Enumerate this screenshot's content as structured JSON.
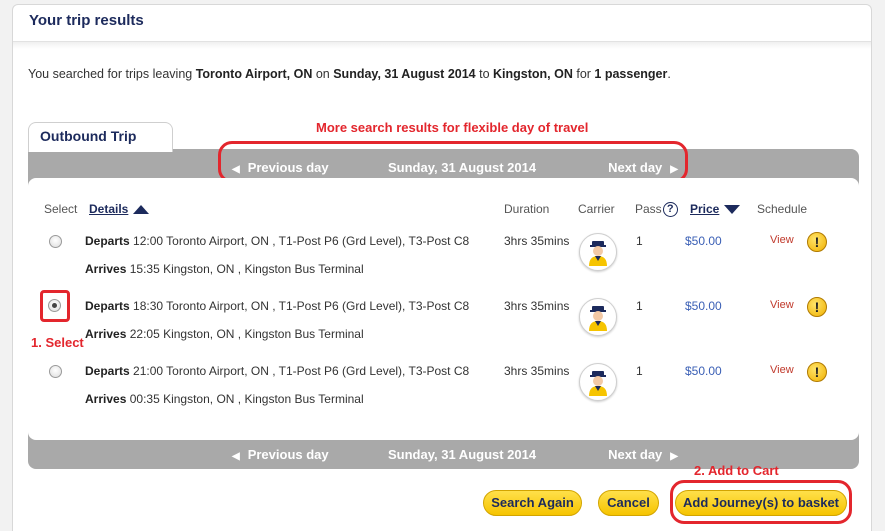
{
  "page": {
    "title": "Your trip results"
  },
  "summary": {
    "prefix": "You searched for trips leaving ",
    "origin": "Toronto Airport, ON",
    "on": " on ",
    "date": "Sunday, 31 August 2014",
    "to": " to ",
    "destination": "Kingston, ON",
    "for": " for ",
    "passengers": "1 passenger",
    "suffix": "."
  },
  "tab": {
    "label": "Outbound Trip"
  },
  "annotations": {
    "flexible": "More search results for flexible day of travel",
    "select": "1. Select",
    "cart": "2. Add to Cart"
  },
  "daynav": {
    "prev": "Previous day",
    "date": "Sunday, 31 August 2014",
    "next": "Next day",
    "prev_icon": "chevron-left-icon",
    "next_icon": "chevron-right-icon"
  },
  "columns": {
    "select": "Select",
    "details": "Details",
    "duration": "Duration",
    "carrier": "Carrier",
    "pass": "Pass",
    "price": "Price",
    "schedule": "Schedule"
  },
  "trips": [
    {
      "departs_label": "Departs",
      "departs": "12:00 Toronto Airport, ON , T1-Post P6 (Grd Level), T3-Post C8",
      "arrives_label": "Arrives",
      "arrives": "15:35 Kingston, ON , Kingston Bus Terminal",
      "duration": "3hrs 35mins",
      "pass": "1",
      "price": "$50.00",
      "view": "View",
      "selected": false
    },
    {
      "departs_label": "Departs",
      "departs": "18:30 Toronto Airport, ON , T1-Post P6 (Grd Level), T3-Post C8",
      "arrives_label": "Arrives",
      "arrives": "22:05 Kingston, ON , Kingston Bus Terminal",
      "duration": "3hrs 35mins",
      "pass": "1",
      "price": "$50.00",
      "view": "View",
      "selected": true
    },
    {
      "departs_label": "Departs",
      "departs": "21:00 Toronto Airport, ON , T1-Post P6 (Grd Level), T3-Post C8",
      "arrives_label": "Arrives",
      "arrives": "00:35 Kingston, ON , Kingston Bus Terminal",
      "duration": "3hrs 35mins",
      "pass": "1",
      "price": "$50.00",
      "view": "View",
      "selected": false
    }
  ],
  "buttons": {
    "search_again": "Search Again",
    "cancel": "Cancel",
    "add_to_basket": "Add Journey(s) to basket"
  },
  "colors": {
    "accent_navy": "#1c2a5c",
    "button_yellow": "#f6c400",
    "annotation_red": "#e3262d",
    "price_blue": "#3a5fb5"
  }
}
